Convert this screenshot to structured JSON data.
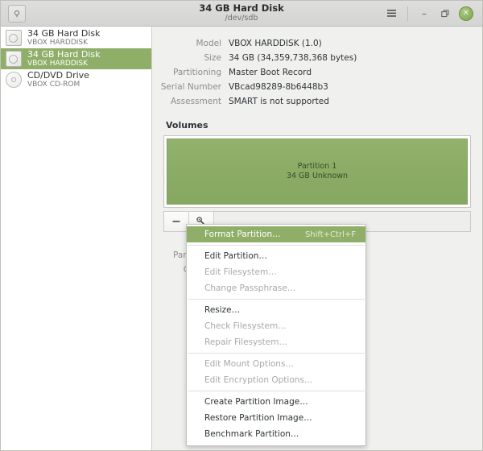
{
  "titlebar": {
    "app_icon": "disk-utility-icon",
    "title": "34 GB Hard Disk",
    "subtitle": "/dev/sdb",
    "menu_icon": "hamburger-menu-icon",
    "minimize_icon": "minimize-icon",
    "maximize_icon": "maximize-restore-icon",
    "close_icon": "close-icon",
    "minimize_glyph": "–",
    "maximize_glyph": "❐",
    "close_glyph": "✕",
    "hamburger_glyph": "≡"
  },
  "sidebar": {
    "items": [
      {
        "title": "34 GB Hard Disk",
        "subtitle": "VBOX HARDDISK",
        "icon": "hard-disk-icon",
        "selected": false
      },
      {
        "title": "34 GB Hard Disk",
        "subtitle": "VBOX HARDDISK",
        "icon": "hard-disk-icon",
        "selected": true
      },
      {
        "title": "CD/DVD Drive",
        "subtitle": "VBOX CD-ROM",
        "icon": "optical-disc-icon",
        "selected": false
      }
    ]
  },
  "details": {
    "rows": [
      {
        "label": "Model",
        "value": "VBOX HARDDISK (1.0)"
      },
      {
        "label": "Size",
        "value": "34 GB (34,359,738,368 bytes)"
      },
      {
        "label": "Partitioning",
        "value": "Master Boot Record"
      },
      {
        "label": "Serial Number",
        "value": "VBcad98289-8b6448b3"
      },
      {
        "label": "Assessment",
        "value": "SMART is not supported"
      }
    ]
  },
  "volumes": {
    "heading": "Volumes",
    "partition": {
      "name": "Partition 1",
      "description": "34 GB Unknown",
      "color": "#8aab64"
    },
    "toolbar": {
      "delete_label": "–",
      "delete_icon": "minus-icon",
      "settings_icon": "gear-wrench-icon",
      "settings_glyph": "⛭"
    }
  },
  "obscured_details": {
    "rows": [
      {
        "label": "Partitioning",
        "value": ""
      },
      {
        "label": "Contents",
        "value": ""
      }
    ]
  },
  "context_menu": {
    "groups": [
      [
        {
          "label": "Format Partition…",
          "accel": "Shift+Ctrl+F",
          "state": "highlight"
        }
      ],
      [
        {
          "label": "Edit Partition…",
          "accel": "",
          "state": "enabled"
        },
        {
          "label": "Edit Filesystem…",
          "accel": "",
          "state": "disabled"
        },
        {
          "label": "Change Passphrase…",
          "accel": "",
          "state": "disabled"
        }
      ],
      [
        {
          "label": "Resize…",
          "accel": "",
          "state": "enabled"
        },
        {
          "label": "Check Filesystem…",
          "accel": "",
          "state": "disabled"
        },
        {
          "label": "Repair Filesystem…",
          "accel": "",
          "state": "disabled"
        }
      ],
      [
        {
          "label": "Edit Mount Options…",
          "accel": "",
          "state": "disabled"
        },
        {
          "label": "Edit Encryption Options…",
          "accel": "",
          "state": "disabled"
        }
      ],
      [
        {
          "label": "Create Partition Image…",
          "accel": "",
          "state": "enabled"
        },
        {
          "label": "Restore Partition Image…",
          "accel": "",
          "state": "enabled"
        },
        {
          "label": "Benchmark Partition…",
          "accel": "",
          "state": "enabled"
        }
      ]
    ]
  },
  "colors": {
    "accent_green": "#8faf68",
    "partition_green": "#8aab64",
    "titlebar_bg": "#dadad8",
    "main_bg": "#f0f0ef",
    "sidebar_bg": "#ffffff"
  }
}
